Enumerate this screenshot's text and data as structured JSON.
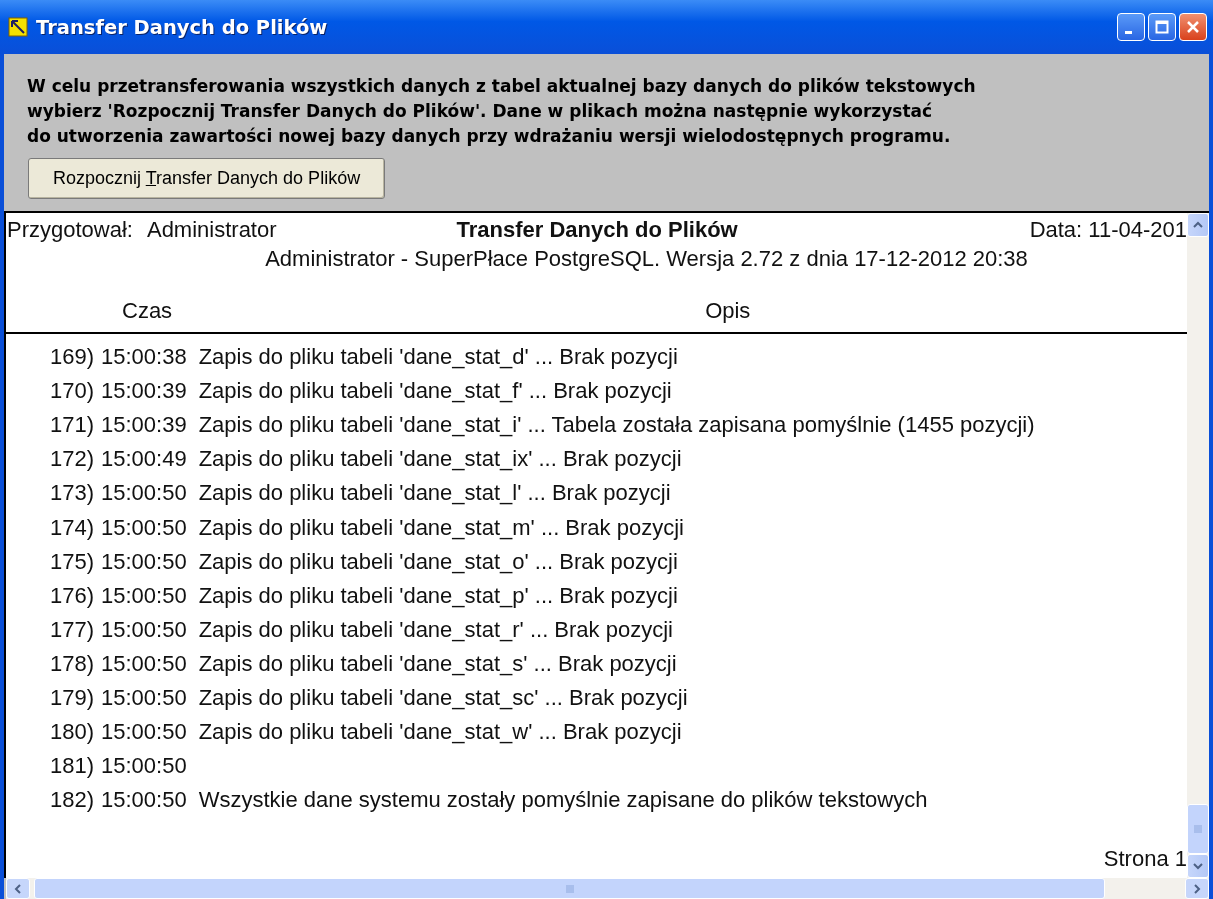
{
  "window": {
    "title": "Transfer Danych do Plików"
  },
  "intro": [
    "W celu przetransferowania wszystkich danych z tabel aktualnej bazy danych do plików tekstowych",
    "wybierz 'Rozpocznij Transfer Danych do Plików'. Dane w plikach można następnie wykorzystać",
    "do utworzenia zawartości nowej bazy danych przy wdrażaniu wersji wielodostępnych programu."
  ],
  "start_button": {
    "label_parts": [
      "Rozpocznij ",
      "T",
      "ransfer Danych do Plików"
    ]
  },
  "report": {
    "prepared_label": "Przygotował:",
    "prepared_by": "Administrator",
    "title": "Transfer Danych do Plików",
    "date": "Data: 11-04-201",
    "subtitle": "Administrator - SuperPłace PostgreSQL. Wersja 2.72 z dnia 17-12-2012 20:38",
    "columns": [
      "Czas",
      "Opis"
    ],
    "rows": [
      {
        "no": "169)",
        "time": "15:00:38",
        "description": "Zapis do pliku tabeli 'dane_stat_d' ... Brak pozycji"
      },
      {
        "no": "170)",
        "time": "15:00:39",
        "description": "Zapis do pliku tabeli 'dane_stat_f' ... Brak pozycji"
      },
      {
        "no": "171)",
        "time": "15:00:39",
        "description": "Zapis do pliku tabeli 'dane_stat_i' ... Tabela została zapisana pomyślnie (1455 pozycji)"
      },
      {
        "no": "172)",
        "time": "15:00:49",
        "description": "Zapis do pliku tabeli 'dane_stat_ix' ... Brak pozycji"
      },
      {
        "no": "173)",
        "time": "15:00:50",
        "description": "Zapis do pliku tabeli 'dane_stat_l' ... Brak pozycji"
      },
      {
        "no": "174)",
        "time": "15:00:50",
        "description": "Zapis do pliku tabeli 'dane_stat_m' ... Brak pozycji"
      },
      {
        "no": "175)",
        "time": "15:00:50",
        "description": "Zapis do pliku tabeli 'dane_stat_o' ... Brak pozycji"
      },
      {
        "no": "176)",
        "time": "15:00:50",
        "description": "Zapis do pliku tabeli 'dane_stat_p' ... Brak pozycji"
      },
      {
        "no": "177)",
        "time": "15:00:50",
        "description": "Zapis do pliku tabeli 'dane_stat_r' ... Brak pozycji"
      },
      {
        "no": "178)",
        "time": "15:00:50",
        "description": "Zapis do pliku tabeli 'dane_stat_s' ... Brak pozycji"
      },
      {
        "no": "179)",
        "time": "15:00:50",
        "description": "Zapis do pliku tabeli 'dane_stat_sc' ... Brak pozycji"
      },
      {
        "no": "180)",
        "time": "15:00:50",
        "description": "Zapis do pliku tabeli 'dane_stat_w' ... Brak pozycji"
      },
      {
        "no": "181)",
        "time": "15:00:50"
      },
      {
        "no": "182)",
        "time": "15:00:50",
        "description": "Wszystkie dane systemu zostały pomyślnie zapisane do plików tekstowych"
      }
    ],
    "page": "Strona 1"
  }
}
